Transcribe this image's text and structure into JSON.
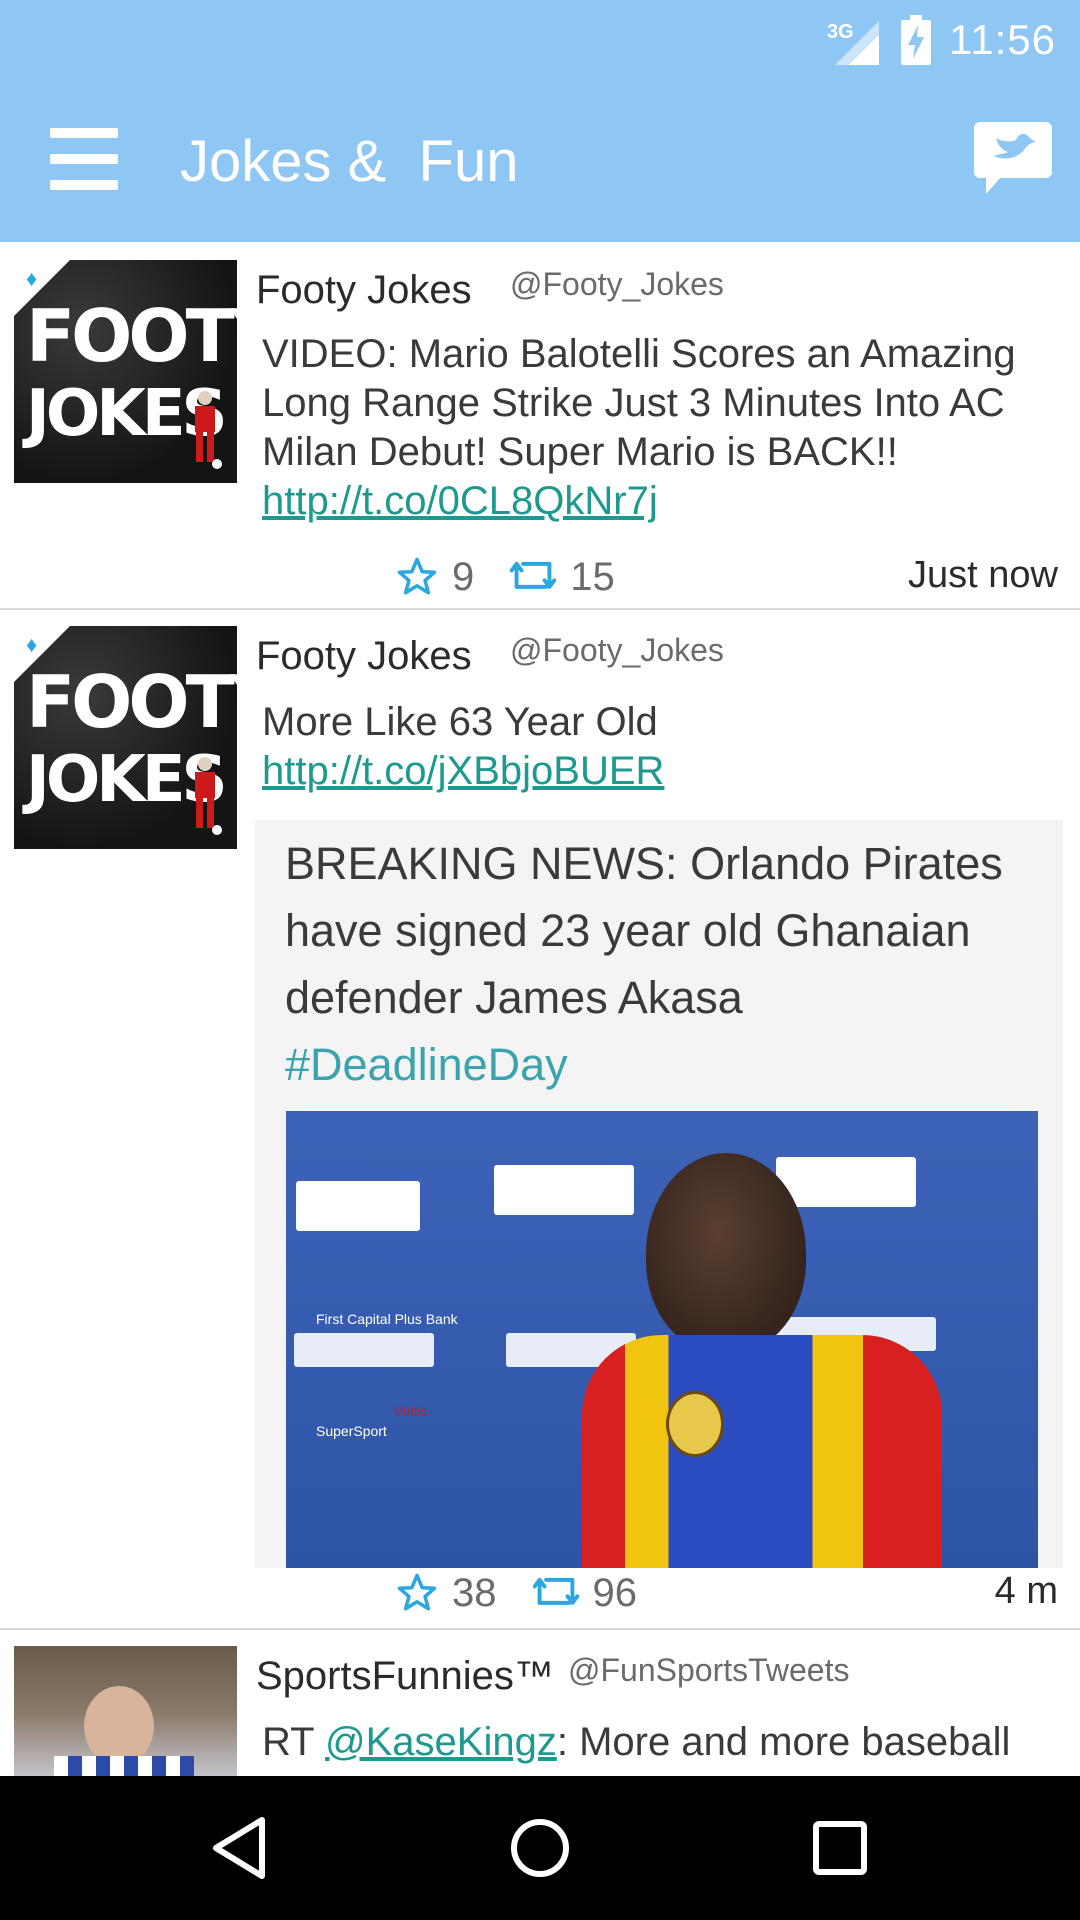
{
  "status_bar": {
    "network": "3G",
    "time": "11:56",
    "icons": [
      "signal-icon",
      "battery-charging-icon"
    ]
  },
  "app_bar": {
    "title": "Jokes &  Fun",
    "menu_icon": "hamburger-menu-icon",
    "compose_icon": "compose-tweet-icon"
  },
  "colors": {
    "app_bar": "#8ec6f4",
    "link": "#1c9a90",
    "action_icon": "#2aa7e0",
    "nav_bar": "#000000"
  },
  "tweets": [
    {
      "name": "Footy Jokes",
      "handle": "@Footy_Jokes",
      "text_before": "VIDEO: Mario Balotelli Scores an Amazing Long Range Strike Just 3 Minutes Into AC Milan Debut! Super Mario is BACK!! ",
      "link": "http://t.co/0CL8QkNr7j",
      "favorites": "9",
      "retweets": "15",
      "time": "Just now",
      "avatar": {
        "line1": "FOOTY",
        "line2": "JOKES"
      }
    },
    {
      "name": "Footy Jokes",
      "handle": "@Footy_Jokes",
      "text_before": "More Like 63 Year Old ",
      "link": "http://t.co/jXBbjoBUER",
      "favorites": "38",
      "retweets": "96",
      "time": "4 m",
      "avatar": {
        "line1": "FOOTY",
        "line2": "JOKES"
      },
      "media": {
        "headline": "BREAKING NEWS: Orlando Pirates have signed 23 year old Ghanaian defender James Akasa",
        "hashtag": "#DeadlineDay",
        "sponsor_text": [
          "First Capital Plus Bank",
          "Voltic",
          "SuperSport"
        ]
      }
    },
    {
      "name": "SportsFunnies™",
      "handle": "@FunSportsTweets",
      "text_before": "RT ",
      "mention": "@KaseKingz",
      "text_after": ": More and more baseball"
    }
  ],
  "nav_bar": {
    "icons": [
      "back-icon",
      "home-icon",
      "recents-icon"
    ]
  }
}
